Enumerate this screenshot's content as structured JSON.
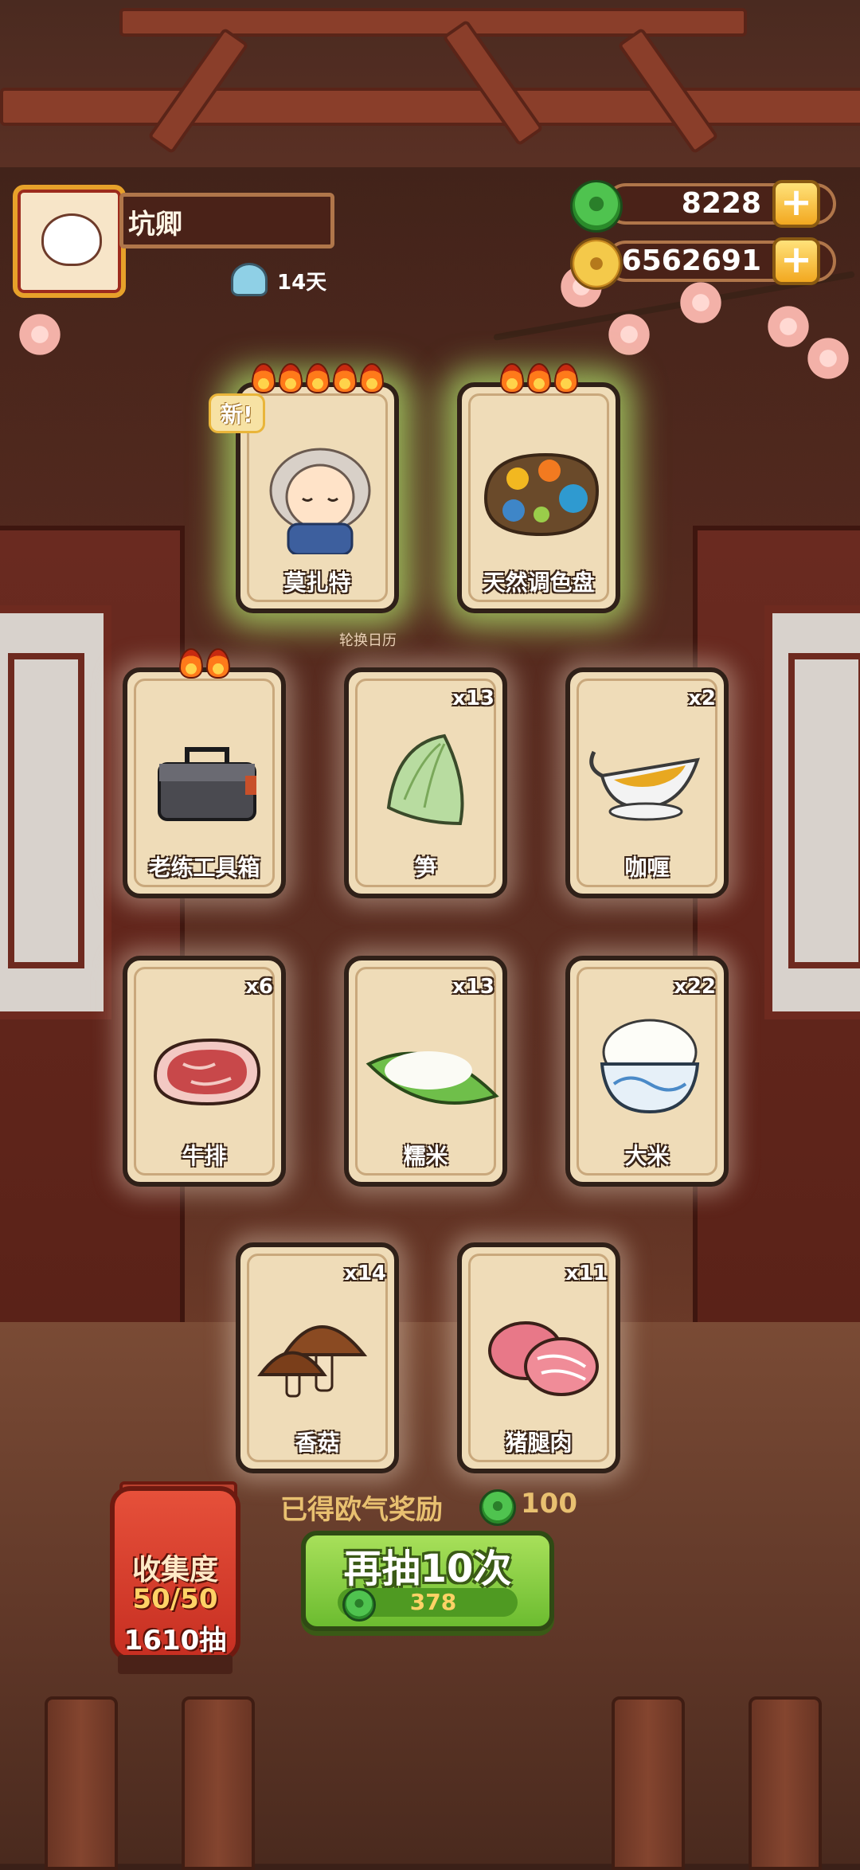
{
  "player": {
    "name": "坑卿",
    "days": "14天"
  },
  "resources": {
    "jade": "8228",
    "coins": "6562691"
  },
  "featured": [
    {
      "name": "莫扎特",
      "flames": 5,
      "new_label": "新!"
    },
    {
      "name": "天然调色盘",
      "flames": 3
    }
  ],
  "rotate_label": "轮换日历",
  "cards": [
    {
      "name": "老练工具箱",
      "qty": "",
      "flames": 2
    },
    {
      "name": "笋",
      "qty": "x13"
    },
    {
      "name": "咖喱",
      "qty": "x2"
    },
    {
      "name": "牛排",
      "qty": "x6"
    },
    {
      "name": "糯米",
      "qty": "x13"
    },
    {
      "name": "大米",
      "qty": "x22"
    },
    {
      "name": "香菇",
      "qty": "x14"
    },
    {
      "name": "猪腿肉",
      "qty": "x11"
    }
  ],
  "reward": {
    "label": "已得欧气奖励",
    "amount": "100"
  },
  "collection": {
    "title": "收集度",
    "progress": "50/50",
    "draws": "1610抽"
  },
  "draw_button": {
    "label": "再抽10次",
    "cost": "378"
  },
  "icons": {
    "jade": "jade-icon",
    "coin": "coin-icon",
    "plus": "plus-icon",
    "days": "calendar-icon",
    "flame": "flame-icon",
    "new": "new-badge"
  },
  "colors": {
    "accent_green": "#6cbc30",
    "gold": "#f2a820",
    "card_bg": "#efdcb8"
  }
}
